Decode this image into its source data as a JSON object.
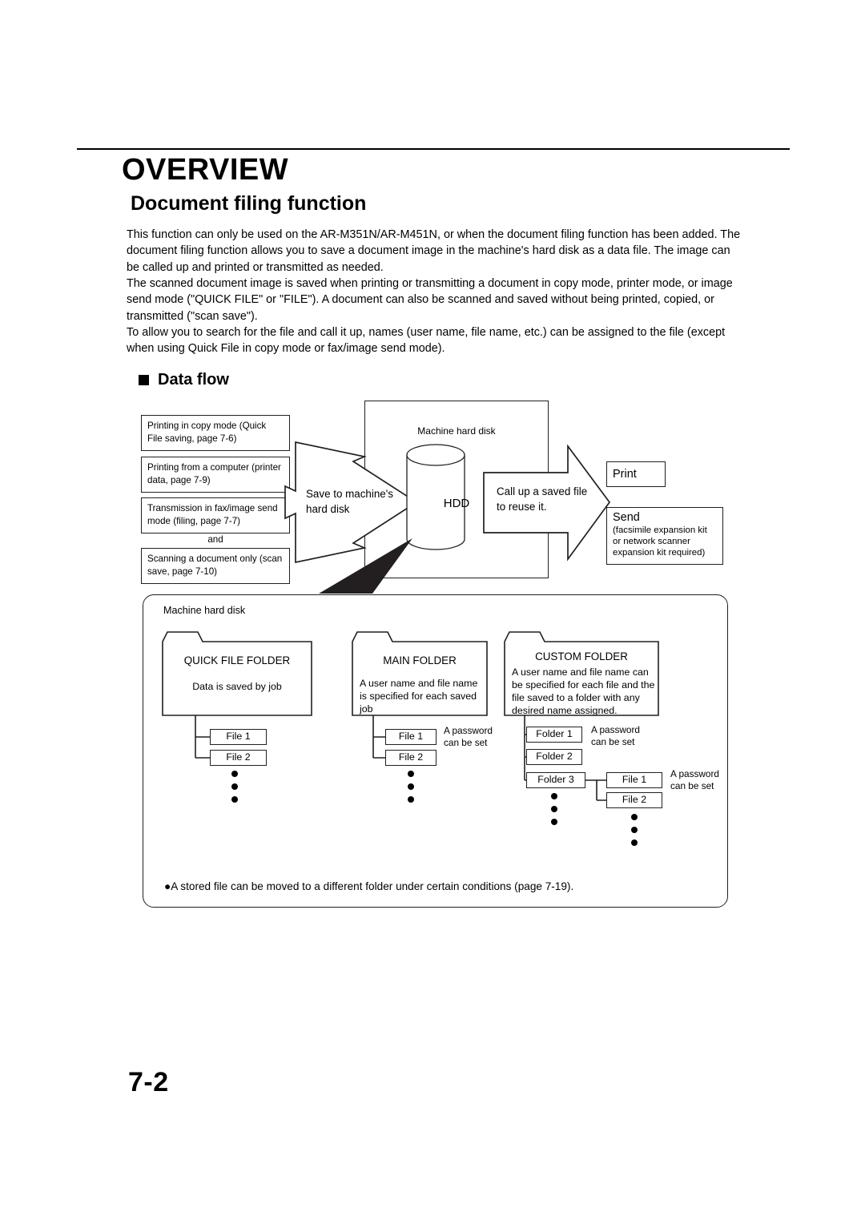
{
  "document": {
    "title": "OVERVIEW",
    "section_title": "Document filing function",
    "paragraphs": [
      "This function can only be used on the AR-M351N/AR-M451N, or when the document filing function has been added. The document filing function allows you to save a document image in the machine's hard disk as a data file. The image can be called up and printed or transmitted as needed.",
      "The scanned document image is saved when printing or transmitting a document in copy mode, printer mode, or image send mode (\"QUICK FILE\" or \"FILE\"). A document can also be scanned and saved without being printed, copied, or transmitted (\"scan save\").",
      "To allow you to search for the file and call it up, names (user name, file name, etc.) can be assigned to the file (except when using Quick File in copy mode or fax/image send mode)."
    ],
    "page_number": "7-2"
  },
  "dataflow": {
    "heading": "Data flow",
    "sources": [
      "Printing in copy mode (Quick File saving, page 7-6)",
      "Printing from a computer (printer data, page 7-9)",
      "Transmission in fax/image send mode (filing, page 7-7)",
      "Scanning a document only (scan save, page 7-10)"
    ],
    "and_label": "and",
    "arrow_left_label": "Save to machine's hard disk",
    "arrow_right_label": "Call up a saved file to reuse it.",
    "hdd_rect_label": "Machine hard disk",
    "hdd_label": "HDD",
    "destinations": {
      "print": "Print",
      "send_title": "Send",
      "send_sub": "(facsimile expansion kit or network scanner expansion kit required)"
    }
  },
  "storage": {
    "panel_label": "Machine hard disk",
    "folders": [
      {
        "title": "QUICK FILE FOLDER",
        "body": "Data is saved by job",
        "items": [
          "File 1",
          "File 2"
        ],
        "note": ""
      },
      {
        "title": "MAIN FOLDER",
        "body": "A user name and file name is specified for each saved job",
        "items": [
          "File 1",
          "File 2"
        ],
        "note": "A password can be set"
      },
      {
        "title": "CUSTOM FOLDER",
        "body": "A user name and file name can be specified for each file and the file saved to a folder with any desired name assigned.",
        "items": [
          "Folder 1",
          "Folder 2",
          "Folder 3"
        ],
        "note": "A password can be set",
        "sub_items": [
          "File 1",
          "File 2"
        ],
        "sub_note": "A password can be set"
      }
    ],
    "footnote": "●A stored file can be moved to a different folder under certain conditions (page 7-19)."
  }
}
